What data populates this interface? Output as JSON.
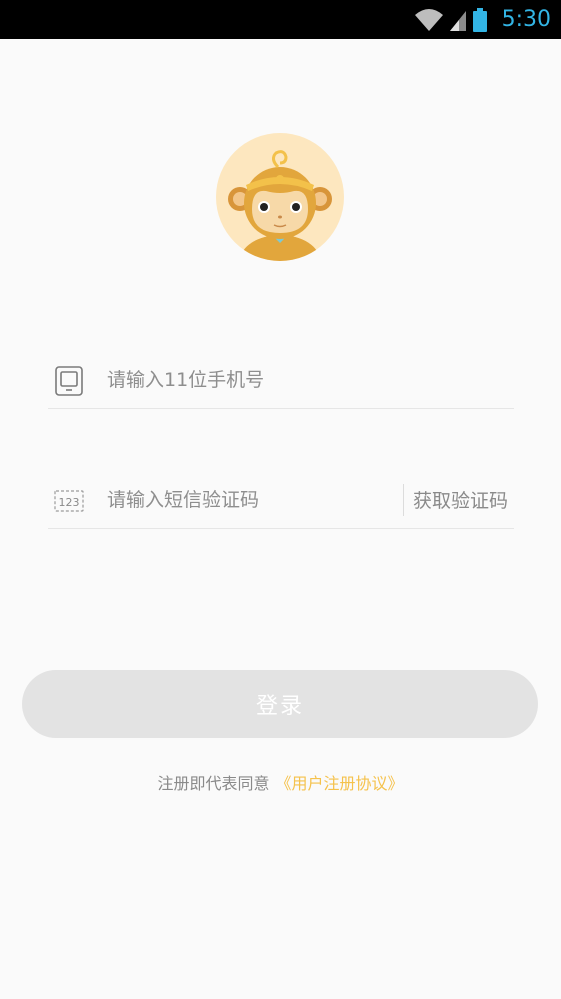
{
  "status_bar": {
    "time": "5:30",
    "icons": [
      "wifi-icon",
      "signal-icon",
      "battery-icon"
    ],
    "time_color": "#33b5e5"
  },
  "avatar": {
    "icon": "monkey-avatar-icon",
    "background": "#fde7bf"
  },
  "phone_field": {
    "icon": "phone-icon",
    "value": "",
    "placeholder": "请输入11位手机号"
  },
  "code_field": {
    "icon": "sms-code-icon",
    "value": "",
    "placeholder": "请输入短信验证码",
    "get_code_label": "获取验证码"
  },
  "login_button": {
    "label": "登录",
    "background": "#e3e3e3"
  },
  "agreement": {
    "text": "注册即代表同意",
    "link_text": "《用户注册协议》",
    "link_color": "#f5c24c"
  }
}
